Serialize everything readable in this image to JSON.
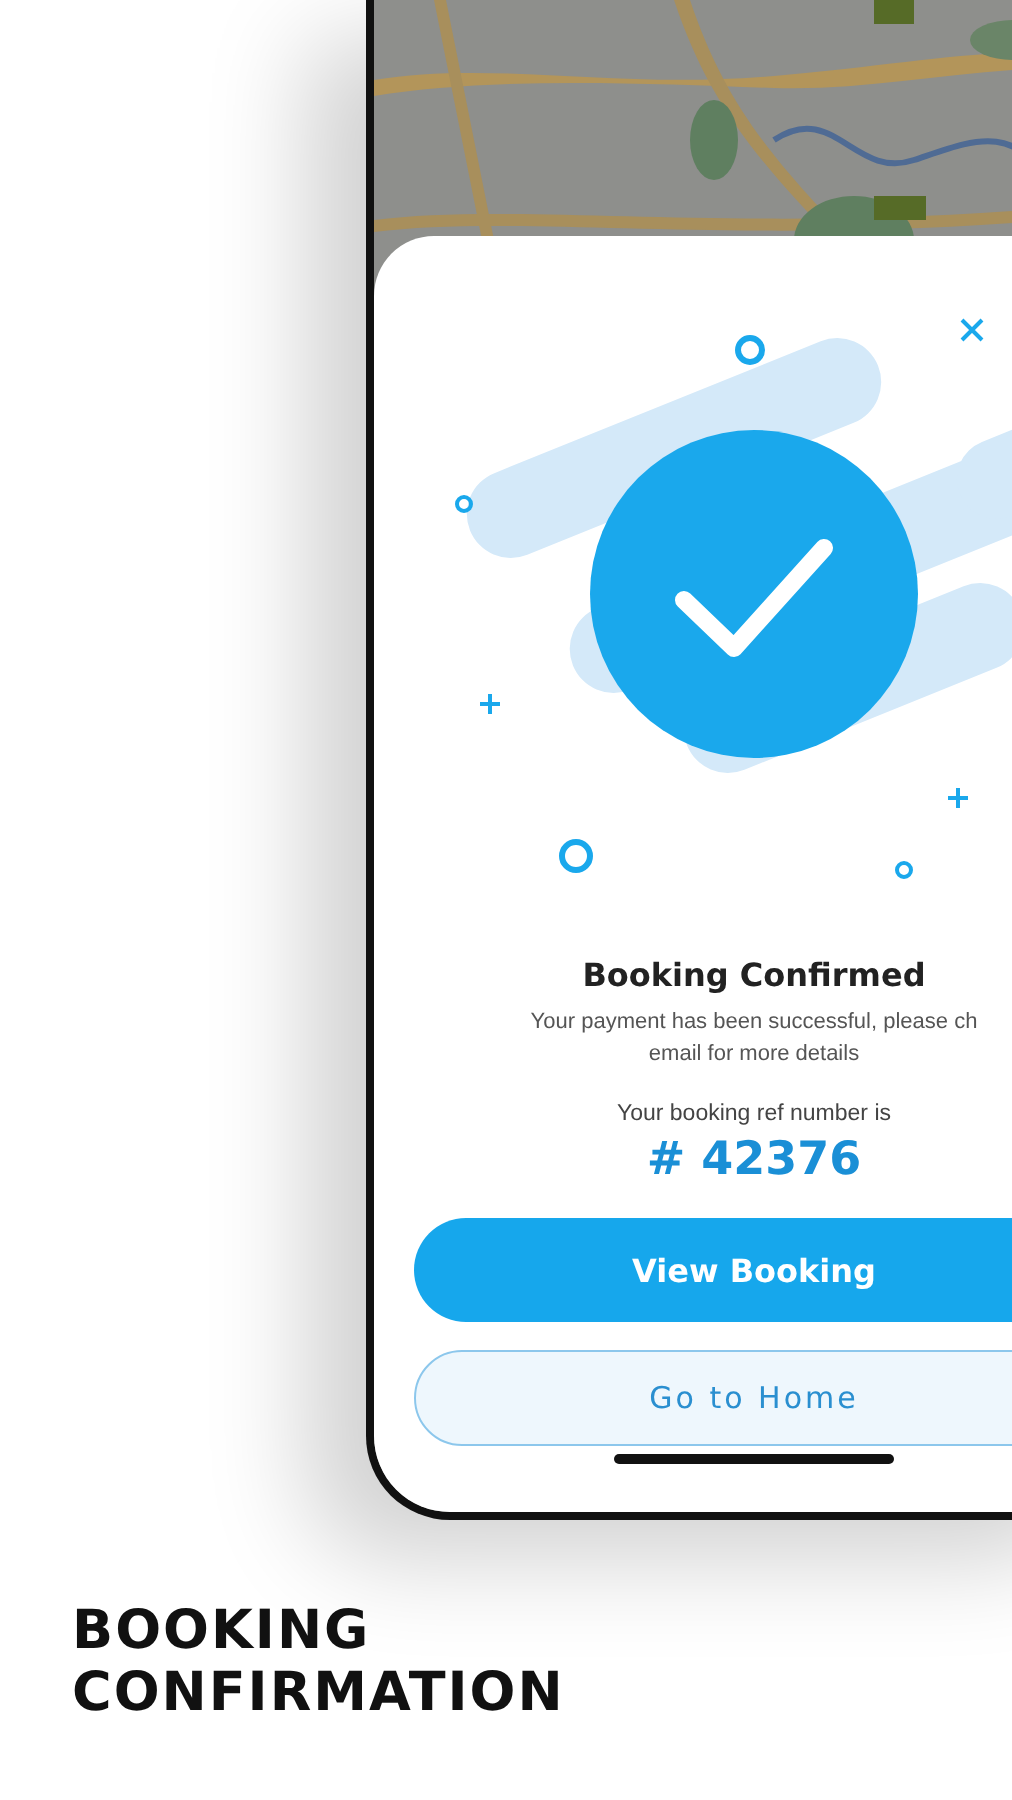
{
  "confirmation": {
    "title": "Booking Confirmed",
    "description_lines": [
      "Your payment has been successful, please ch",
      "email for more details"
    ],
    "ref_label": "Your booking ref number is",
    "ref_number": "# 42376"
  },
  "buttons": [
    {
      "label": "View Booking",
      "kind": "primary"
    },
    {
      "label": "Go to Home",
      "kind": "secondary"
    }
  ],
  "caption": "BOOKING CONFIRMATION"
}
